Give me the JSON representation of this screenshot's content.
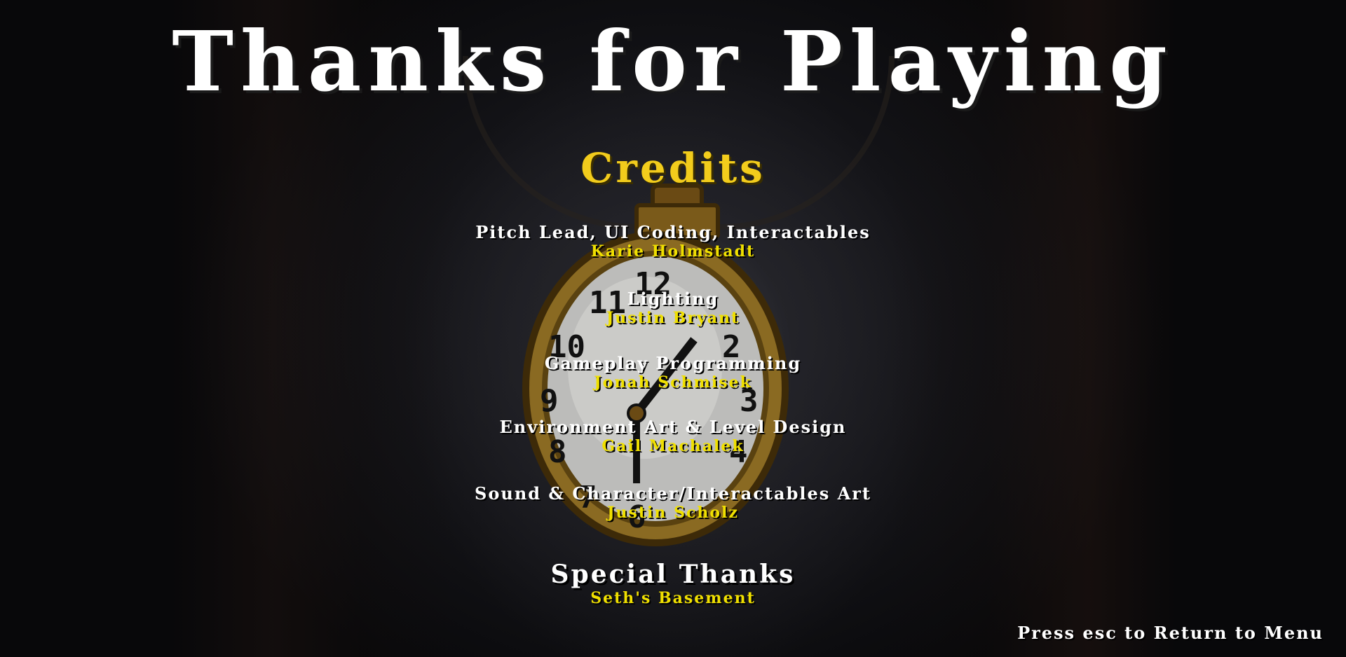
{
  "screen": {
    "title": "Thanks for Playing",
    "credits_heading": "Credits",
    "credits": [
      {
        "role": "Pitch Lead, UI Coding, Interactables",
        "name": "Karie Holmstadt"
      },
      {
        "role": "Lighting",
        "name": "Justin Bryant"
      },
      {
        "role": "Gameplay Programming",
        "name": "Jonah Schmisek"
      },
      {
        "role": "Environment Art & Level Design",
        "name": "Gail Machalek"
      },
      {
        "role": "Sound & Character/Interactables Art",
        "name": "Justin Scholz"
      }
    ],
    "special_thanks": {
      "role": "Special Thanks",
      "name": "Seth's Basement"
    },
    "hint": "Press esc to Return to Menu"
  },
  "watch": {
    "numerals": [
      "12",
      "11",
      "10",
      "9",
      "8",
      "7",
      "6",
      "4",
      "3",
      "2"
    ]
  },
  "colors": {
    "title": "#ffffff",
    "accent_gold": "#f2cc1c",
    "name_yellow": "#f0e000",
    "watch_rim": "#7a5a1a",
    "background": "#0a0a0c"
  }
}
